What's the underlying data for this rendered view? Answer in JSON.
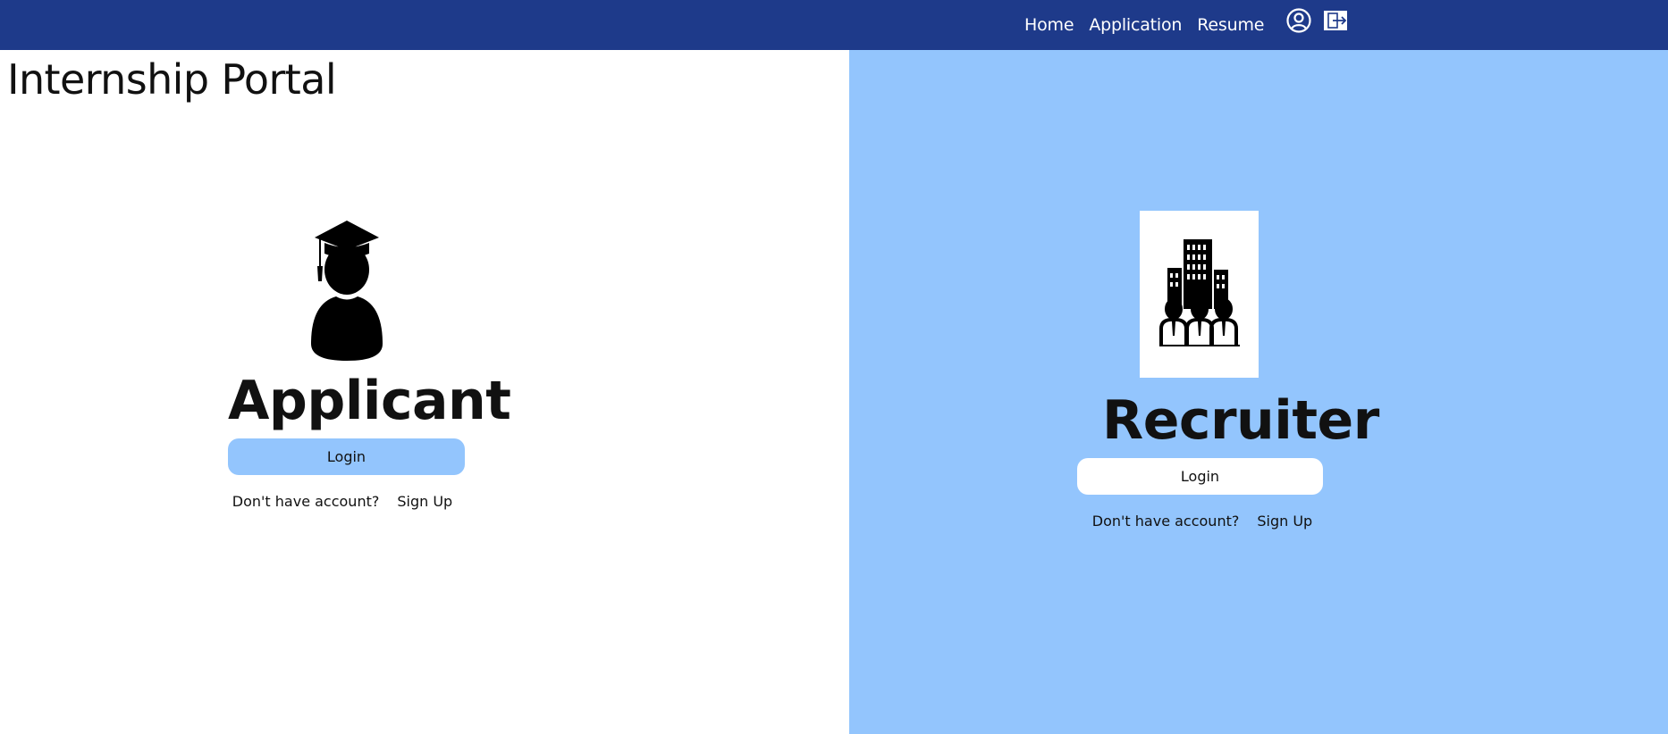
{
  "colors": {
    "topbar": "#1e3a8a",
    "right_panel": "#93c5fd",
    "applicant_login_bg": "#93c5fd",
    "recruiter_login_bg": "#ffffff"
  },
  "nav": {
    "links": [
      {
        "label": "Home"
      },
      {
        "label": "Application"
      },
      {
        "label": "Resume"
      }
    ],
    "icons": [
      "user-circle-icon",
      "logout-icon"
    ]
  },
  "page": {
    "title": "Internship Portal"
  },
  "applicant": {
    "icon": "graduate-icon",
    "title": "Applicant",
    "login_label": "Login",
    "no_account_text": "Don't have account?",
    "signup_label": "Sign Up"
  },
  "recruiter": {
    "icon": "company-building-icon",
    "title": "Recruiter",
    "login_label": "Login",
    "no_account_text": "Don't have account?",
    "signup_label": "Sign Up"
  }
}
